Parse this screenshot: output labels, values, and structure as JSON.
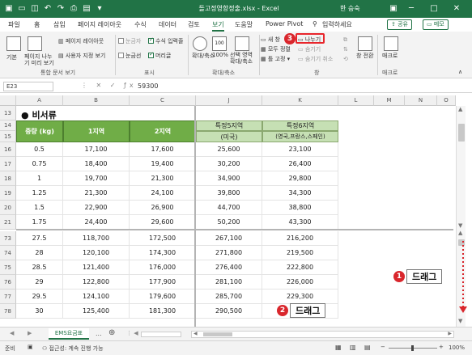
{
  "title_bar": {
    "title": "돌고정영항정출.xlsx - Excel",
    "user": "한 승숙"
  },
  "menu_tabs": [
    "파일",
    "홈",
    "삽입",
    "페이지 레이아웃",
    "수식",
    "데이터",
    "검토",
    "보기",
    "도움말",
    "Power Pivot",
    "입력하세요"
  ],
  "active_tab": "보기",
  "buttons": {
    "share": "공유",
    "memo": "메모"
  },
  "ribbon": {
    "view_basic": "기본",
    "page_break": "페이지 나누기 미리 보기",
    "page_layout": "페이지 레이아웃",
    "custom_view": "사용자 지정 보기",
    "group_workbook_view": "통합 문서 보기",
    "ruler": "눈금자",
    "formula_bar": "수식 입력줄",
    "gridlines": "눈금선",
    "headings": "머리글",
    "group_show": "표시",
    "zoom": "확대/축소",
    "zoom100": "100%",
    "zoom_selection": "선택 영역 확대/축소",
    "group_zoom": "확대/축소",
    "new_window": "새 창",
    "arrange_all": "모두 정렬",
    "freeze_panes": "틀 고정",
    "split": "나누기",
    "hide": "숨기기",
    "unhide": "숨기기 취소",
    "group_window": "창",
    "switch_window": "창 전환",
    "macros": "매크로",
    "group_macro": "매크로"
  },
  "formula_bar": {
    "name_box": "E23",
    "value": "59300"
  },
  "columns": [
    "A",
    "B",
    "C",
    "J",
    "K",
    "L",
    "M",
    "N",
    "O"
  ],
  "section_title": "비서류",
  "headers": {
    "weight": "중량 (kg)",
    "zone1": "1지역",
    "zone2": "2지역",
    "special5": "특정5지역",
    "special5_sub": "(미국)",
    "special6": "특정6지역",
    "special6_sub": "(영국,프랑스,스페인)"
  },
  "rows_top": [
    {
      "row": "16",
      "weight": "0.5",
      "z1": "17,100",
      "z2": "17,600",
      "s5": "25,600",
      "s6": "23,100"
    },
    {
      "row": "17",
      "weight": "0.75",
      "z1": "18,400",
      "z2": "19,400",
      "s5": "30,200",
      "s6": "26,400"
    },
    {
      "row": "18",
      "weight": "1",
      "z1": "19,700",
      "z2": "21,300",
      "s5": "34,900",
      "s6": "29,800"
    },
    {
      "row": "19",
      "weight": "1.25",
      "z1": "21,300",
      "z2": "24,100",
      "s5": "39,800",
      "s6": "34,300"
    },
    {
      "row": "20",
      "weight": "1.5",
      "z1": "22,900",
      "z2": "26,900",
      "s5": "44,700",
      "s6": "38,800"
    },
    {
      "row": "21",
      "weight": "1.75",
      "z1": "24,400",
      "z2": "29,600",
      "s5": "50,200",
      "s6": "43,300"
    }
  ],
  "rows_bottom": [
    {
      "row": "73",
      "weight": "27.5",
      "z1": "118,700",
      "z2": "172,500",
      "s5": "267,100",
      "s6": "216,200"
    },
    {
      "row": "74",
      "weight": "28",
      "z1": "120,100",
      "z2": "174,300",
      "s5": "271,800",
      "s6": "219,500"
    },
    {
      "row": "75",
      "weight": "28.5",
      "z1": "121,400",
      "z2": "176,000",
      "s5": "276,400",
      "s6": "222,800"
    },
    {
      "row": "76",
      "weight": "29",
      "z1": "122,800",
      "z2": "177,900",
      "s5": "281,100",
      "s6": "226,000"
    },
    {
      "row": "77",
      "weight": "29.5",
      "z1": "124,100",
      "z2": "179,600",
      "s5": "285,700",
      "s6": "229,300"
    },
    {
      "row": "78",
      "weight": "30",
      "z1": "125,400",
      "z2": "181,300",
      "s5": "290,500",
      "s6": ""
    }
  ],
  "sheet_tab": "EMS요금표",
  "status": {
    "ready": "준비",
    "accessibility": "접근성: 계속 진행 가능",
    "zoom": "100%"
  },
  "callouts": {
    "badge1": "1",
    "drag1": "드래그",
    "badge2": "2",
    "drag2": "드래그",
    "badge3": "3"
  },
  "colors": {
    "excel_green": "#217346",
    "header_green": "#70ad47",
    "light_green": "#c6e0b4",
    "callout_red": "#d9262c"
  }
}
